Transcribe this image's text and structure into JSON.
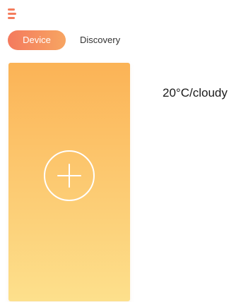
{
  "header": {
    "menu_icon": "hamburger-menu-icon"
  },
  "tabs": [
    {
      "label": "Device",
      "active": true
    },
    {
      "label": "Discovery",
      "active": false
    }
  ],
  "device_card": {
    "icon": "add-circle-icon"
  },
  "weather": {
    "text": "20°C/cloudy"
  },
  "colors": {
    "accent": "#f47c5c",
    "tab_gradient_start": "#f47a5e",
    "tab_gradient_end": "#f7a562",
    "card_gradient_top": "#fbb356",
    "card_gradient_bottom": "#fde08c"
  }
}
